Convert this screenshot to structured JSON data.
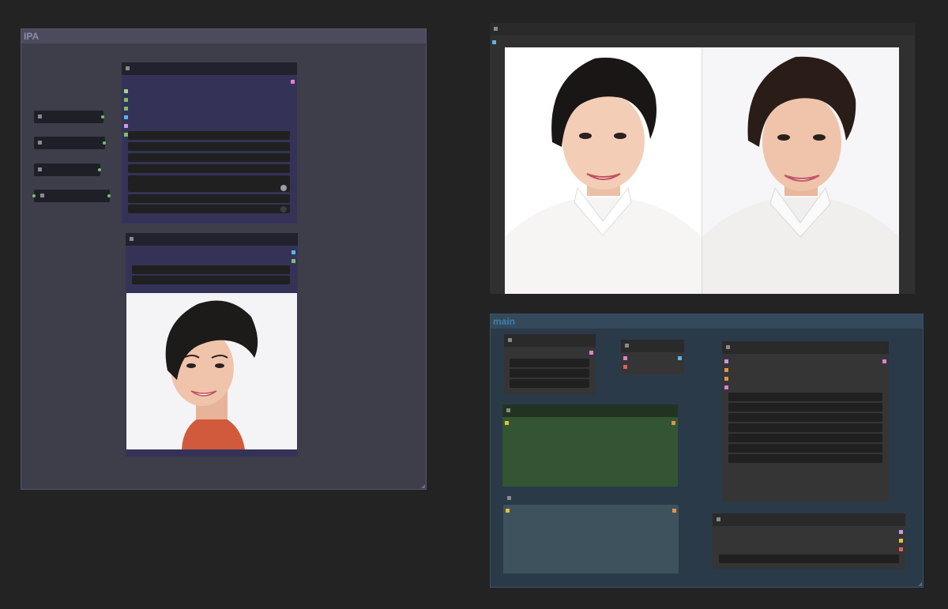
{
  "groups": {
    "ipa": {
      "title": "IPA",
      "color": "#3e3d4a",
      "title_bg": "#4c4b5e",
      "title_color": "#8d8ca8"
    },
    "main": {
      "title": "main",
      "color": "#2b3a48",
      "title_bg": "#34495b",
      "title_color": "#3f7fae"
    }
  },
  "slot_colors": {
    "green": "#7bbf6a",
    "purple": "#c59ae6",
    "blue": "#5cb4e8",
    "yellow": "#e2c235",
    "orange": "#e0944a",
    "red": "#e05d5d",
    "pink": "#e07fd6"
  },
  "nodes": {
    "ipadapter": {
      "widget_count": 8,
      "toggles": 2
    },
    "load_image": {
      "widget_count": 2
    },
    "compare": {
      "images": 2
    },
    "main_ksampler": {
      "widget_count": 7
    },
    "main_loader": {
      "widget_count": 3
    }
  },
  "icons": {
    "node_collapse": "square-dot-icon",
    "resize": "resize-corner-icon"
  }
}
